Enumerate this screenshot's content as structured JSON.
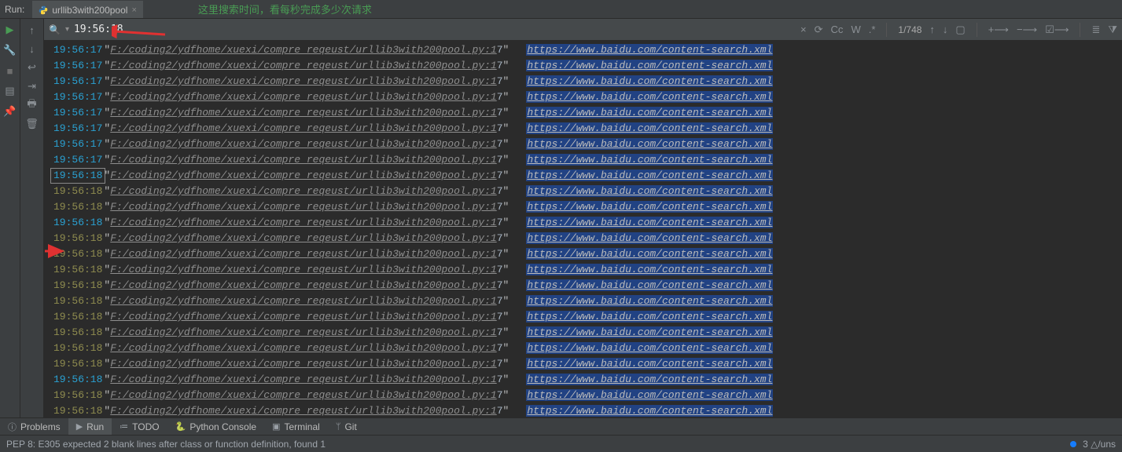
{
  "header": {
    "run_label": "Run:",
    "tab_name": "urllib3with200pool",
    "green_note": "这里搜索时间，看每秒完成多少次请求"
  },
  "search": {
    "value": "19:56:18",
    "counter": "1/748",
    "options": {
      "cc": "Cc",
      "ww": "W",
      "regex": ".*"
    }
  },
  "log": {
    "path_text": "F:/coding2/ydfhome/xuexi/compre_reqeust/urllib3with200pool.py:1",
    "last7": "7",
    "url_text": "https://www.baidu.com/content-search.xml",
    "rows": [
      {
        "ts": "19:56:17",
        "ts_style": "blue"
      },
      {
        "ts": "19:56:17",
        "ts_style": "blue"
      },
      {
        "ts": "19:56:17",
        "ts_style": "blue"
      },
      {
        "ts": "19:56:17",
        "ts_style": "blue"
      },
      {
        "ts": "19:56:17",
        "ts_style": "blue"
      },
      {
        "ts": "19:56:17",
        "ts_style": "blue"
      },
      {
        "ts": "19:56:17",
        "ts_style": "blue"
      },
      {
        "ts": "19:56:17",
        "ts_style": "blue"
      },
      {
        "ts": "19:56:18",
        "ts_style": "boxed"
      },
      {
        "ts": "19:56:18",
        "ts_style": "olive"
      },
      {
        "ts": "19:56:18",
        "ts_style": "olive"
      },
      {
        "ts": "19:56:18",
        "ts_style": "blue"
      },
      {
        "ts": "19:56:18",
        "ts_style": "olive"
      },
      {
        "ts": "19:56:18",
        "ts_style": "olive"
      },
      {
        "ts": "19:56:18",
        "ts_style": "olive"
      },
      {
        "ts": "19:56:18",
        "ts_style": "olive"
      },
      {
        "ts": "19:56:18",
        "ts_style": "olive"
      },
      {
        "ts": "19:56:18",
        "ts_style": "olive"
      },
      {
        "ts": "19:56:18",
        "ts_style": "olive"
      },
      {
        "ts": "19:56:18",
        "ts_style": "olive"
      },
      {
        "ts": "19:56:18",
        "ts_style": "olive"
      },
      {
        "ts": "19:56:18",
        "ts_style": "blue"
      },
      {
        "ts": "19:56:18",
        "ts_style": "olive"
      },
      {
        "ts": "19:56:18",
        "ts_style": "olive"
      }
    ]
  },
  "bottom": {
    "problems": "Problems",
    "run": "Run",
    "todo": "TODO",
    "python_console": "Python Console",
    "terminal": "Terminal",
    "git": "Git"
  },
  "status": {
    "pep8": "PEP 8: E305 expected 2 blank lines after class or function definition, found 1",
    "right": "3 △/uns"
  }
}
